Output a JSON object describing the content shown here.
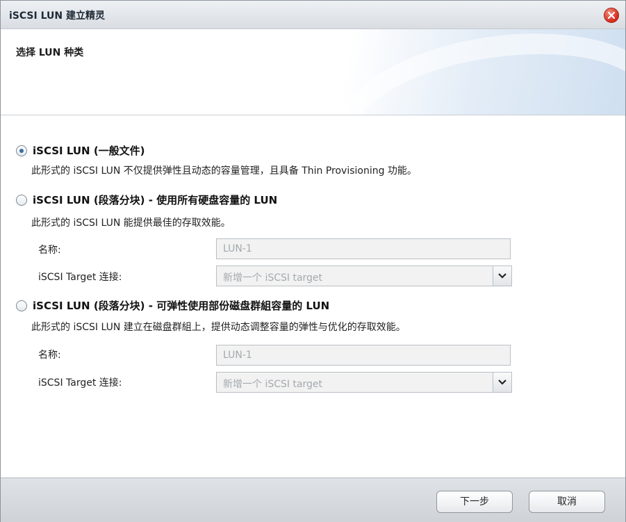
{
  "window": {
    "title": "iSCSI LUN 建立精灵"
  },
  "header": {
    "title": "选择 LUN 种类"
  },
  "options": [
    {
      "label": "iSCSI LUN (一般文件)",
      "selected": true,
      "description": "此形式的 iSCSI LUN 不仅提供弹性且动态的容量管理，且具备 Thin Provisioning 功能。"
    },
    {
      "label": "iSCSI LUN (段落分块) - 使用所有硬盘容量的 LUN",
      "selected": false,
      "description": "此形式的 iSCSI LUN 能提供最佳的存取效能。",
      "name_label": "名称:",
      "name_value": "LUN-1",
      "target_label": "iSCSI Target 连接:",
      "target_value": "新增一个 iSCSI target"
    },
    {
      "label": "iSCSI LUN (段落分块) - 可弹性使用部份磁盘群組容量的 LUN",
      "selected": false,
      "description": "此形式的 iSCSI LUN 建立在磁盘群組上，提供动态调整容量的弹性与优化的存取效能。",
      "name_label": "名称:",
      "name_value": "LUN-1",
      "target_label": "iSCSI Target 连接:",
      "target_value": "新增一个 iSCSI target"
    }
  ],
  "footer": {
    "next_label": "下一步",
    "cancel_label": "取消"
  }
}
